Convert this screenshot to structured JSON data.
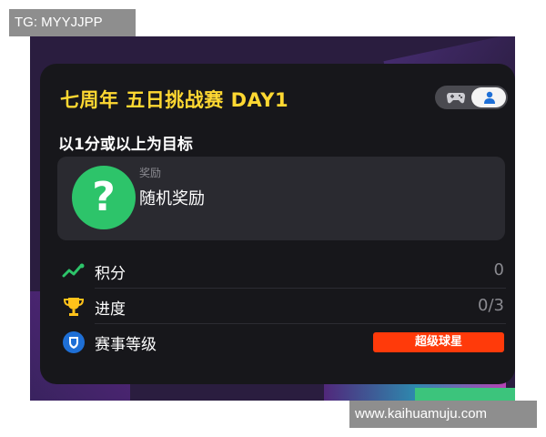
{
  "watermarks": {
    "top_left": "TG: MYYJJPP",
    "bottom_right": "www.kaihuamuju.com"
  },
  "card": {
    "title": "七周年 五日挑战赛 DAY1",
    "subtitle": "以1分或以上为目标",
    "toggle": {
      "left_icon": "gamepad-icon",
      "right_icon": "person-icon",
      "selected": "person"
    },
    "reward": {
      "label": "奖励",
      "name": "随机奖励",
      "icon": "question-mark-icon"
    },
    "rows": [
      {
        "icon": "trend-icon",
        "label": "积分",
        "value": "0"
      },
      {
        "icon": "trophy-icon",
        "label": "进度",
        "value": "0/3"
      },
      {
        "icon": "shield-icon",
        "label": "赛事等级",
        "badge": "超级球星"
      }
    ]
  },
  "colors": {
    "title": "#ffd832",
    "reward_circle": "#2dc46a",
    "badge": "#ff3a0a",
    "card_bg": "#17171b"
  }
}
